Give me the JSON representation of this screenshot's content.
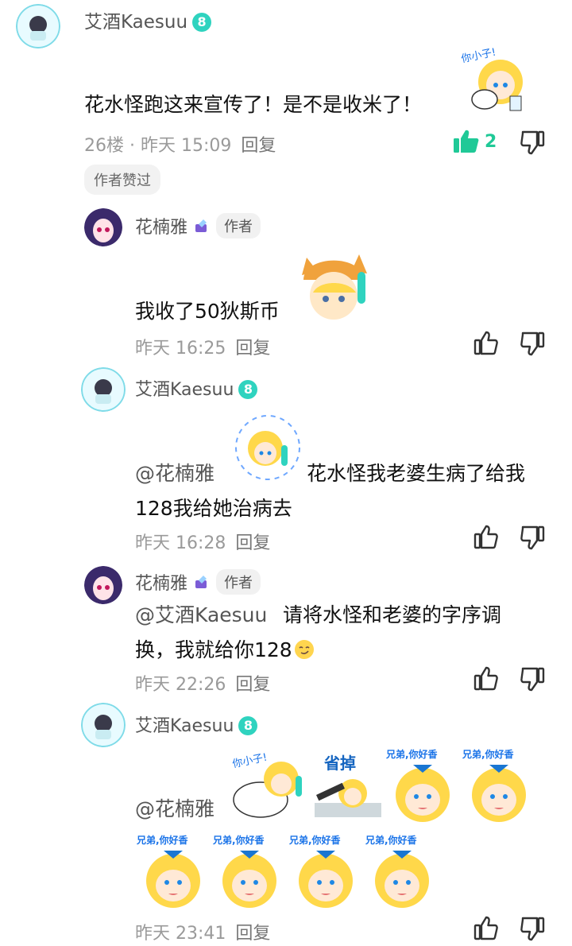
{
  "comments": [
    {
      "user": "艾酒Kaesuu",
      "level": "8",
      "text": "花水怪跑这来宣传了！是不是收米了！",
      "meta": "26楼 · 昨天 15:09",
      "reply": "回复",
      "likes": "2",
      "liked_by_author": "作者赞过",
      "sticker_text": "你小子!"
    },
    {
      "user": "花楠雅",
      "author_badge": "作者",
      "text": "我收了50狄斯币",
      "meta": "昨天 16:25",
      "reply": "回复"
    },
    {
      "user": "艾酒Kaesuu",
      "level": "8",
      "mention": "@花楠雅",
      "text_line1": "花水怪我老婆生病了给我",
      "text_line2": "128我给她治病去",
      "meta": "昨天 16:28",
      "reply": "回复"
    },
    {
      "user": "花楠雅",
      "author_badge": "作者",
      "mention": "@艾酒Kaesuu",
      "text_line1": "请将水怪和老婆的字序调",
      "text_line2": "换，我就给你128",
      "meta": "昨天 22:26",
      "reply": "回复"
    },
    {
      "user": "艾酒Kaesuu",
      "level": "8",
      "mention": "@花楠雅",
      "meta": "昨天 23:41",
      "reply": "回复",
      "sticker_texts": [
        "你小子!",
        "省掉",
        "兄弟,你好香"
      ]
    }
  ],
  "colors": {
    "accent": "#2fd3bf",
    "like_active": "#20c997",
    "meta": "#9a9a9a"
  },
  "icons": [
    "thumb-up-icon",
    "thumb-down-icon",
    "level-badge-icon",
    "pin-icon"
  ]
}
